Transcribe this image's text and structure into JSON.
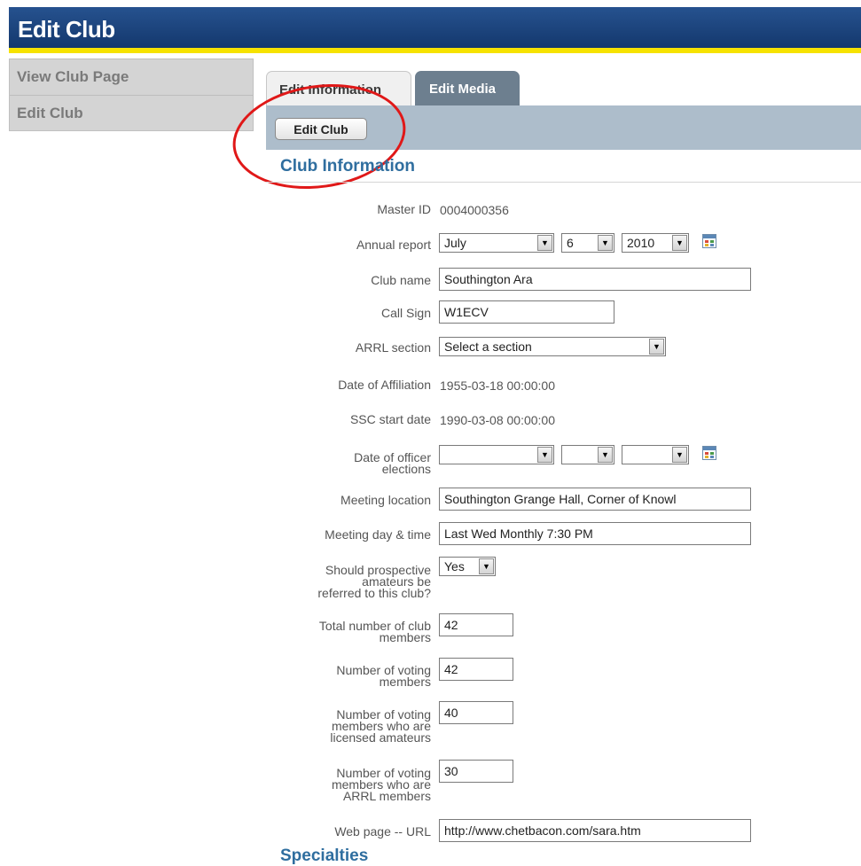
{
  "header": {
    "title": "Edit Club"
  },
  "sidebar": {
    "items": [
      {
        "label": "View Club Page"
      },
      {
        "label": "Edit Club"
      }
    ]
  },
  "tabs": [
    {
      "label": "Edit Information"
    },
    {
      "label": "Edit Media"
    }
  ],
  "toolbar": {
    "edit_club_label": "Edit Club"
  },
  "section_title": "Club Information",
  "next_section_title": "Specialties",
  "colors": {
    "title_bar": "#1c457c",
    "accent_stripe": "#f6e200",
    "section_title": "#2f6e9f",
    "toolbar_bg": "#adbdcb",
    "annotation_circle": "#e01818"
  },
  "form": {
    "master_id": {
      "label": "Master ID",
      "value": "0004000356"
    },
    "annual_report": {
      "label": "Annual report",
      "month": "July",
      "day": "6",
      "year": "2010",
      "icon": "calendar-icon"
    },
    "club_name": {
      "label": "Club name",
      "value": "Southington Ara"
    },
    "call_sign": {
      "label": "Call Sign",
      "value": "W1ECV"
    },
    "arrl_section": {
      "label": "ARRL section",
      "value": "Select a section"
    },
    "date_of_affiliation": {
      "label": "Date of Affiliation",
      "value": "1955-03-18 00:00:00"
    },
    "ssc_start_date": {
      "label": "SSC start date",
      "value": "1990-03-08 00:00:00"
    },
    "officer_elections": {
      "label_line1": "Date of officer",
      "label_line2": "elections",
      "month": "",
      "day": "",
      "year": "",
      "icon": "calendar-icon"
    },
    "meeting_location": {
      "label": "Meeting location",
      "value": "Southington Grange Hall, Corner of Knowl"
    },
    "meeting_day_time": {
      "label": "Meeting day & time",
      "value": "Last Wed Monthly  7:30 PM"
    },
    "refer_prospective": {
      "label_line1": "Should prospective",
      "label_line2": "amateurs be",
      "label_line3": "referred to this club?",
      "value": "Yes"
    },
    "total_members": {
      "label_line1": "Total number of club",
      "label_line2": "members",
      "value": "42"
    },
    "voting_members": {
      "label_line1": "Number of voting",
      "label_line2": "members",
      "value": "42"
    },
    "voting_licensed": {
      "label_line1": "Number of voting",
      "label_line2": "members who are",
      "label_line3": "licensed amateurs",
      "value": "40"
    },
    "voting_arrl": {
      "label_line1": "Number of voting",
      "label_line2": "members who are",
      "label_line3": "ARRL members",
      "value": "30"
    },
    "web_url": {
      "label": "Web page -- URL",
      "value": "http://www.chetbacon.com/sara.htm"
    }
  }
}
